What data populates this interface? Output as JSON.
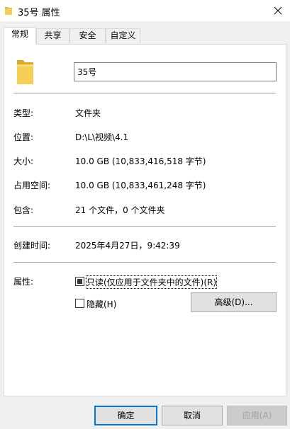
{
  "window": {
    "title": "35号 属性",
    "close_icon": "close-icon"
  },
  "tabs": [
    {
      "label": "常规",
      "active": true
    },
    {
      "label": "共享",
      "active": false
    },
    {
      "label": "安全",
      "active": false
    },
    {
      "label": "自定义",
      "active": false
    }
  ],
  "general": {
    "name_value": "35号",
    "rows": {
      "type": {
        "label": "类型:",
        "value": "文件夹"
      },
      "location": {
        "label": "位置:",
        "value": "D:\\L\\视频\\4.1"
      },
      "size": {
        "label": "大小:",
        "value": "10.0 GB (10,833,416,518 字节)"
      },
      "size_on_disk": {
        "label": "占用空间:",
        "value": "10.0 GB (10,833,461,248 字节)"
      },
      "contains": {
        "label": "包含:",
        "value": "21 个文件，0 个文件夹"
      },
      "created": {
        "label": "创建时间:",
        "value": "2025年4月27日，9:42:39"
      }
    },
    "attributes": {
      "label": "属性:",
      "readonly_label": "只读(仅应用于文件夹中的文件)(R)",
      "readonly_state": "indeterminate",
      "hidden_label": "隐藏(H)",
      "hidden_state": "unchecked",
      "advanced_label": "高级(D)..."
    }
  },
  "buttons": {
    "ok": "确定",
    "cancel": "取消",
    "apply": "应用(A)"
  },
  "colors": {
    "accent": "#0078d7",
    "folder": "#f0c94a"
  }
}
